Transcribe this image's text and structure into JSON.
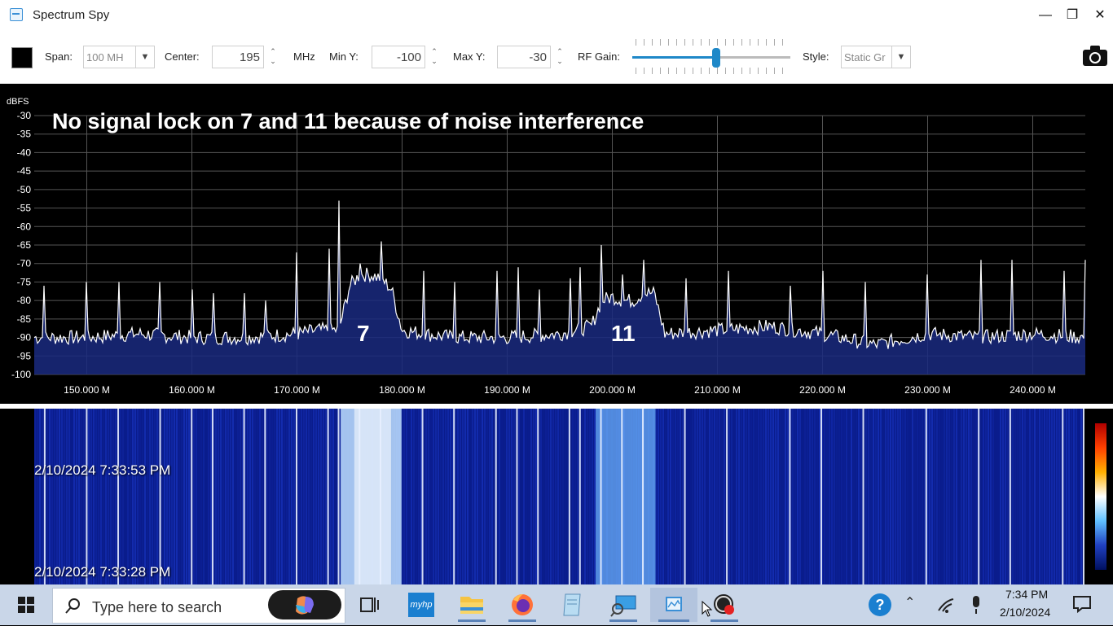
{
  "window": {
    "title": "Spectrum Spy",
    "controls": {
      "minimize": "—",
      "restore": "❐",
      "close": "✕"
    }
  },
  "toolbar": {
    "span_label": "Span:",
    "span_value": "100 MH",
    "center_label": "Center:",
    "center_value": "195",
    "center_unit": "MHz",
    "miny_label": "Min Y:",
    "miny_value": "-100",
    "maxy_label": "Max Y:",
    "maxy_value": "-30",
    "rfgain_label": "RF Gain:",
    "rfgain_level": 0.53,
    "style_label": "Style:",
    "style_value": "Static Gr",
    "colors": {
      "accent": "#1e88c8"
    }
  },
  "spectrum": {
    "annotation": "No signal lock on 7 and 11 because of noise interference",
    "channel_labels": [
      "7",
      "11"
    ],
    "y_unit": "dBFS",
    "y_ticks": [
      "-30",
      "-35",
      "-40",
      "-45",
      "-50",
      "-55",
      "-60",
      "-65",
      "-70",
      "-75",
      "-80",
      "-85",
      "-90",
      "-95",
      "-100"
    ],
    "x_ticks": [
      "150.000 M",
      "160.000 M",
      "170.000 M",
      "180.000 M",
      "190.000 M",
      "200.000 M",
      "210.000 M",
      "220.000 M",
      "230.000 M",
      "240.000 M"
    ],
    "colors": {
      "trace": "#ffffff",
      "fill": "#1a2a80",
      "grid": "#555555"
    }
  },
  "chart_data": {
    "type": "line",
    "title": "",
    "xlabel": "",
    "ylabel": "dBFS",
    "xlim": [
      145,
      245
    ],
    "ylim": [
      -100,
      -30
    ],
    "grid": true,
    "series": [
      {
        "values_note": "",
        "x": [
          145,
          150,
          155,
          160,
          165,
          170,
          172,
          174,
          175,
          176,
          177,
          178,
          179,
          180,
          182,
          185,
          190,
          195,
          198,
          199,
          200,
          201,
          202,
          203,
          204,
          205,
          210,
          215,
          220,
          225,
          230,
          235,
          240,
          245
        ],
        "y": [
          -90,
          -90,
          -89,
          -90,
          -90,
          -89,
          -88,
          -88,
          -76,
          -73,
          -73,
          -74,
          -77,
          -88,
          -89,
          -90,
          -90,
          -89,
          -87,
          -80,
          -79,
          -80,
          -80,
          -78,
          -78,
          -89,
          -88,
          -87,
          -89,
          -92,
          -89,
          -90,
          -89,
          -90
        ]
      }
    ],
    "peaks": {
      "x": [
        146,
        150,
        153,
        157,
        160,
        162,
        165,
        167,
        170,
        173,
        174,
        176,
        178,
        182,
        185,
        189,
        191,
        193,
        196,
        197,
        199,
        201,
        203,
        207,
        211,
        217,
        220,
        224,
        230,
        235,
        238,
        243,
        245
      ],
      "y": [
        -76,
        -75,
        -75,
        -75,
        -77,
        -78,
        -78,
        -80,
        -67,
        -66,
        -53,
        -70,
        -64,
        -72,
        -75,
        -72,
        -71,
        -77,
        -74,
        -71,
        -65,
        -73,
        -69,
        -74,
        -72,
        -76,
        -72,
        -75,
        -73,
        -69,
        -69,
        -72,
        -69
      ]
    }
  },
  "waterfall": {
    "timestamps": [
      "2/10/2024 7:33:53 PM",
      "2/10/2024 7:33:28 PM"
    ]
  },
  "taskbar": {
    "search_placeholder": "Type here to search",
    "apps": [
      "task-view",
      "myhp",
      "file-explorer",
      "firefox",
      "notepad",
      "remote-desktop",
      "spectrum-spy",
      "obs"
    ],
    "myhp_label": "myhp",
    "help_label": "?",
    "clock_time": "7:34 PM",
    "clock_date": "2/10/2024"
  }
}
